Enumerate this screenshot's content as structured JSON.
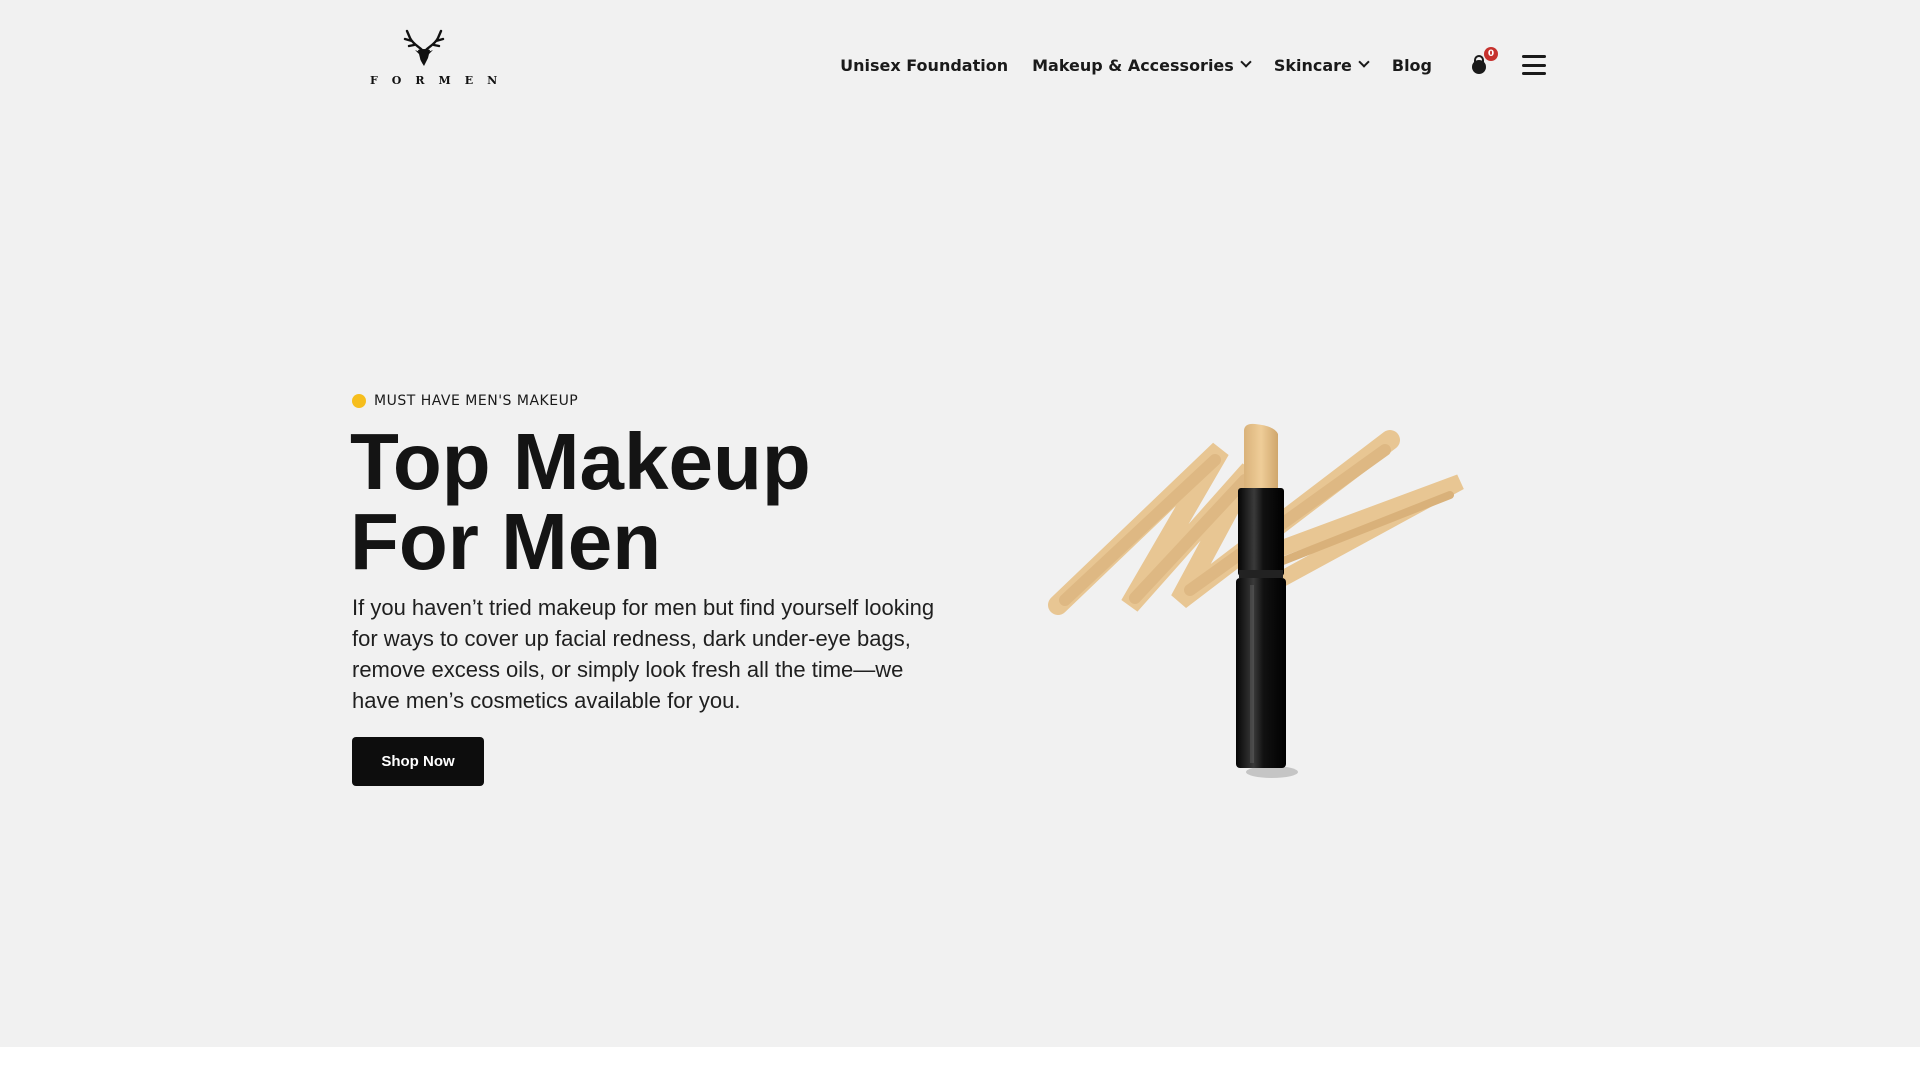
{
  "brand": {
    "name": "FORMEN",
    "logo_icon": "deer-antlers-icon"
  },
  "nav": {
    "items": [
      {
        "label": "Unisex Foundation",
        "has_dropdown": false
      },
      {
        "label": "Makeup & Accessories",
        "has_dropdown": true
      },
      {
        "label": "Skincare",
        "has_dropdown": true
      },
      {
        "label": "Blog",
        "has_dropdown": false
      }
    ],
    "cart_icon": "shopping-bag-icon",
    "cart_count": "0",
    "menu_icon": "hamburger-menu-icon"
  },
  "hero": {
    "eyebrow": "MUST HAVE MEN'S MAKEUP",
    "title_line1": "Top Makeup",
    "title_line2": "For Men",
    "description": "If you haven’t tried makeup for men but find yourself looking for ways to cover up facial redness, dark under-eye bags, remove excess oils, or simply look fresh all the time—we have men’s cosmetics available for you.",
    "cta_label": "Shop Now",
    "product_image": "concealer-stick-with-swatch"
  },
  "colors": {
    "background": "#f1f1f1",
    "accent_dot": "#f6be1d",
    "badge": "#c6312d",
    "button": "#0d0d0d",
    "swatch": "#e8c48e"
  }
}
